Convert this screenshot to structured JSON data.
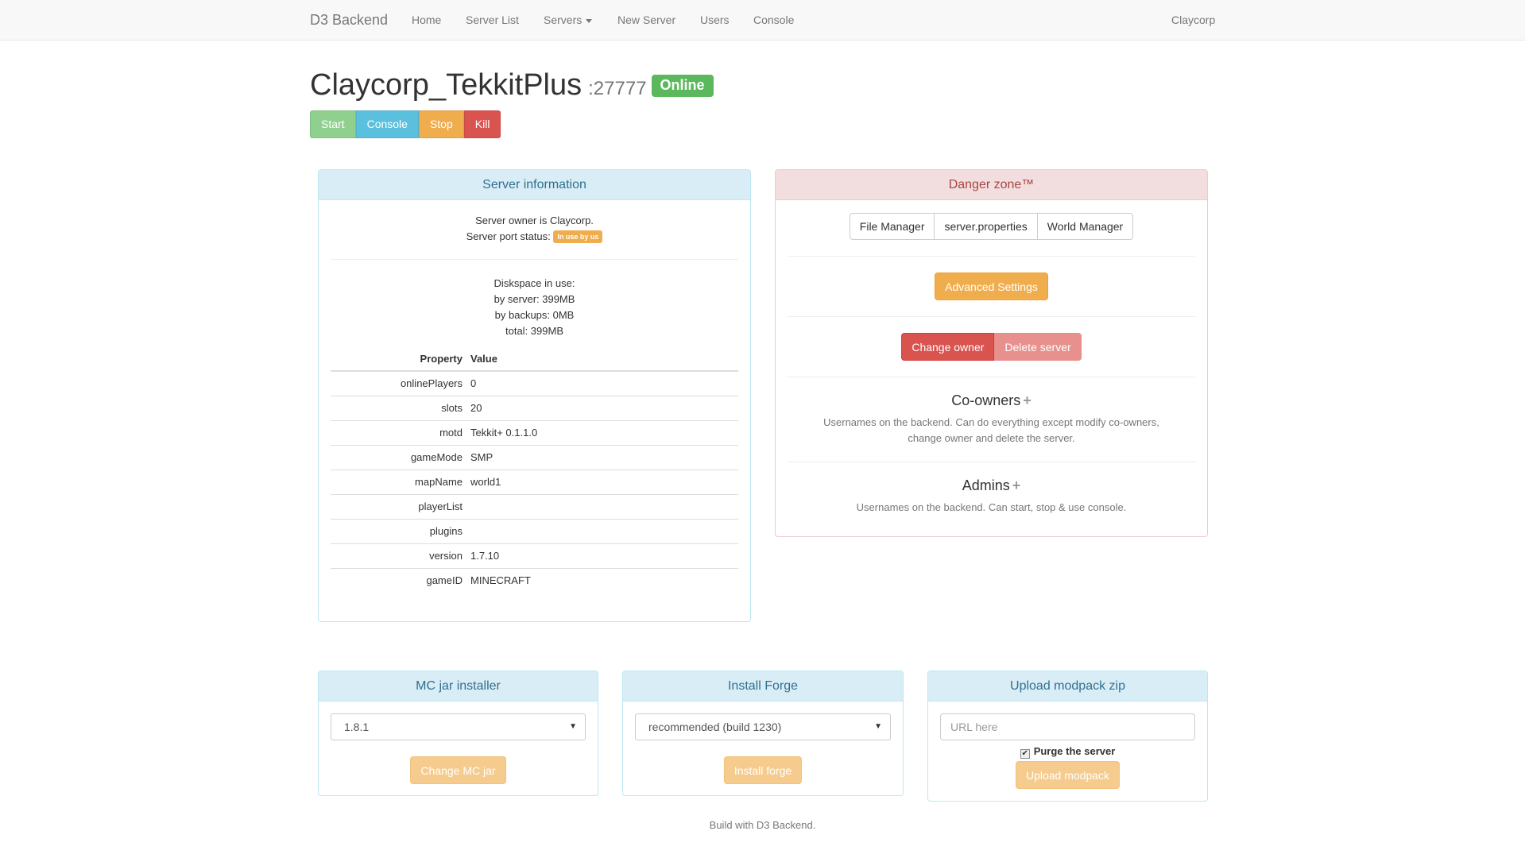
{
  "navbar": {
    "brand": "D3 Backend",
    "links": [
      "Home",
      "Server List",
      "Servers",
      "New Server",
      "Users",
      "Console"
    ],
    "user": "Claycorp"
  },
  "server": {
    "name": "Claycorp_TekkitPlus",
    "port": ":27777",
    "status": "Online",
    "actions": [
      "Start",
      "Console",
      "Stop",
      "Kill"
    ]
  },
  "info_panel": {
    "heading": "Server information",
    "owner_line": "Server owner is Claycorp.",
    "port_status_label": "Server port status:",
    "port_status_badge": "In use by us",
    "disk": {
      "title": "Diskspace in use:",
      "server": "by server: 399MB",
      "backups": "by backups: 0MB",
      "total": "total: 399MB"
    },
    "table_headers": [
      "Property",
      "Value"
    ],
    "properties": [
      {
        "key": "onlinePlayers",
        "value": "0"
      },
      {
        "key": "slots",
        "value": "20"
      },
      {
        "key": "motd",
        "value": "Tekkit+ 0.1.1.0"
      },
      {
        "key": "gameMode",
        "value": "SMP"
      },
      {
        "key": "mapName",
        "value": "world1"
      },
      {
        "key": "playerList",
        "value": ""
      },
      {
        "key": "plugins",
        "value": ""
      },
      {
        "key": "version",
        "value": "1.7.10"
      },
      {
        "key": "gameID",
        "value": "MINECRAFT"
      }
    ]
  },
  "danger_panel": {
    "heading": "Danger zone™",
    "tools": [
      "File Manager",
      "server.properties",
      "World Manager"
    ],
    "advanced": "Advanced Settings",
    "change_owner": "Change owner",
    "delete_server": "Delete server",
    "coowners": {
      "title": "Co-owners",
      "plus": "+",
      "desc_line1": "Usernames on the backend. Can do everything except modify co-owners,",
      "desc_line2": "change owner and delete the server."
    },
    "admins": {
      "title": "Admins",
      "plus": "+",
      "desc": "Usernames on the backend. Can start, stop & use console."
    }
  },
  "mc_jar_panel": {
    "heading": "MC jar installer",
    "selected": "1.8.1",
    "button": "Change MC jar"
  },
  "forge_panel": {
    "heading": "Install Forge",
    "selected": "recommended (build 1230)",
    "button": "Install forge"
  },
  "modpack_panel": {
    "heading": "Upload modpack zip",
    "placeholder": "URL here",
    "checkbox_label": "Purge the server",
    "checkbox_checked": true,
    "button": "Upload modpack"
  },
  "footer": "Build with D3 Backend.",
  "colors": {
    "success": "#5cb85c",
    "info": "#5bc0de",
    "warning": "#f0ad4e",
    "danger": "#d9534f",
    "panel_info_bg": "#d9edf7",
    "panel_danger_bg": "#f2dede"
  }
}
